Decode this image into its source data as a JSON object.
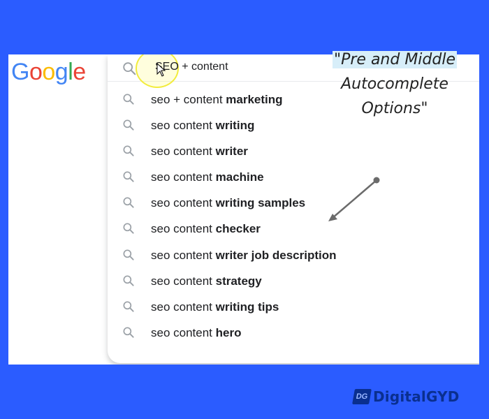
{
  "logo": {
    "letters": [
      "G",
      "o",
      "o",
      "g",
      "l",
      "e"
    ],
    "colors": [
      "#4285F4",
      "#EA4335",
      "#FBBC05",
      "#4285F4",
      "#34A853",
      "#EA4335"
    ]
  },
  "search": {
    "query": "SEO + content",
    "icon": "search-icon"
  },
  "suggestions": [
    {
      "prefix": "seo + content ",
      "bold": "marketing"
    },
    {
      "prefix": "seo content ",
      "bold": "writing"
    },
    {
      "prefix": "seo content ",
      "bold": "writer"
    },
    {
      "prefix": "seo content ",
      "bold": "machine"
    },
    {
      "prefix": "seo content ",
      "bold": "writing samples"
    },
    {
      "prefix": "seo content ",
      "bold": "checker"
    },
    {
      "prefix": "seo content ",
      "bold": "writer job description"
    },
    {
      "prefix": "seo content ",
      "bold": "strategy"
    },
    {
      "prefix": "seo content ",
      "bold": "writing tips"
    },
    {
      "prefix": "seo content ",
      "bold": "hero"
    }
  ],
  "annotation": {
    "line1": "\"Pre and Middle",
    "line2": "Autocomplete",
    "line3": "Options\""
  },
  "brand": {
    "badge": "DG",
    "name": "DigitalGYD"
  },
  "colors": {
    "background": "#2b5cff",
    "brand": "#0a2f8f",
    "highlight": "#d7eef9",
    "cursor_ring": "#f2ec3c"
  }
}
